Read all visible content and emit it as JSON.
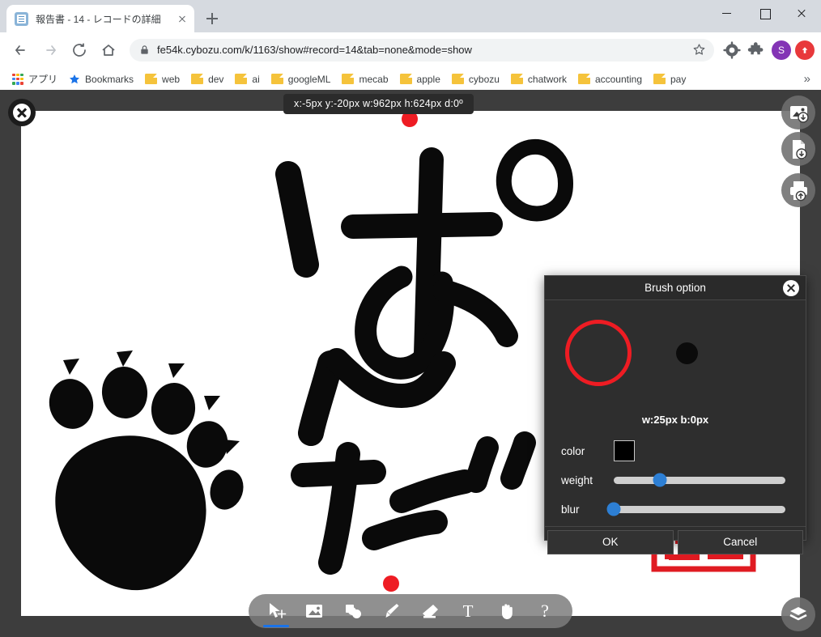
{
  "browser": {
    "tab": {
      "title": "報告書 - 14 - レコードの詳細",
      "favicon": "document-icon"
    },
    "newtab_label": "+",
    "window": {
      "minimize": "minimize-icon",
      "maximize": "maximize-icon",
      "close": "close-icon"
    },
    "nav": {
      "back": "back-arrow-icon",
      "forward": "forward-arrow-icon",
      "reload": "reload-icon",
      "home": "home-icon"
    },
    "omnibox": {
      "lock": "lock-icon",
      "url": "fe54k.cybozu.com/k/1163/show#record=14&tab=none&mode=show",
      "star": "bookmark-star-icon"
    },
    "toolbar_icons": [
      "gear-icon",
      "extensions-puzzle-icon"
    ],
    "profile_initial": "S",
    "bookmarks": [
      {
        "label": "アプリ",
        "icon": "apps-grid-icon"
      },
      {
        "label": "Bookmarks",
        "icon": "star-icon"
      },
      {
        "label": "web",
        "icon": "folder-icon"
      },
      {
        "label": "dev",
        "icon": "folder-icon"
      },
      {
        "label": "ai",
        "icon": "folder-icon"
      },
      {
        "label": "googleML",
        "icon": "folder-icon"
      },
      {
        "label": "mecab",
        "icon": "folder-icon"
      },
      {
        "label": "apple",
        "icon": "folder-icon"
      },
      {
        "label": "cybozu",
        "icon": "folder-icon"
      },
      {
        "label": "chatwork",
        "icon": "folder-icon"
      },
      {
        "label": "accounting",
        "icon": "folder-icon"
      },
      {
        "label": "pay",
        "icon": "folder-icon"
      }
    ],
    "bookmarks_overflow": "»"
  },
  "editor": {
    "hud": "x:-5px  y:-20px  w:962px  h:624px  d:0º",
    "close_label": "close-editor",
    "canvas": {
      "background": "#ffffff",
      "handwriting_text": "ぱんだ",
      "illustration": "bear-paw-print",
      "stamp": "red-hanko-seal"
    },
    "right_tools": [
      {
        "name": "export-image-button",
        "icon": "image-download-icon"
      },
      {
        "name": "save-file-button",
        "icon": "file-download-icon"
      },
      {
        "name": "print-button",
        "icon": "printer-upload-icon"
      }
    ],
    "layers_button": {
      "name": "layers-button",
      "icon": "layers-icon"
    },
    "dock_tools": [
      {
        "name": "tool-select-move",
        "icon": "cursor-move-icon",
        "active": true
      },
      {
        "name": "tool-image",
        "icon": "image-icon",
        "active": false
      },
      {
        "name": "tool-shapes",
        "icon": "shapes-icon",
        "active": false
      },
      {
        "name": "tool-brush",
        "icon": "brush-icon",
        "active": false
      },
      {
        "name": "tool-eraser",
        "icon": "eraser-icon",
        "active": false
      },
      {
        "name": "tool-text",
        "icon": "text-icon",
        "active": false
      },
      {
        "name": "tool-hand",
        "icon": "hand-icon",
        "active": false
      },
      {
        "name": "tool-help",
        "icon": "question-mark-icon",
        "active": false
      }
    ],
    "selection_handles": {
      "color": "#ee1c23",
      "count": 2
    }
  },
  "dialog": {
    "title": "Brush option",
    "close_icon": "close-icon",
    "preview": {
      "ring_color": "#ee1c23",
      "dot_color": "#0b0b0b"
    },
    "size_readout": "w:25px b:0px",
    "fields": {
      "color_label": "color",
      "color_value": "#000000",
      "weight_label": "weight",
      "weight_percent": 27,
      "blur_label": "blur",
      "blur_percent": 0
    },
    "buttons": {
      "ok": "OK",
      "cancel": "Cancel"
    }
  }
}
